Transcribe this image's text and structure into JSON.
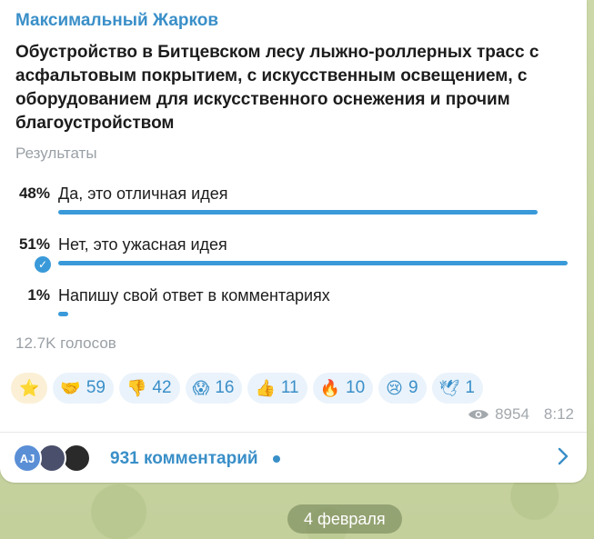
{
  "post": {
    "author": "Максимальный Жарков",
    "question": "Обустройство в Битцевском лесу лыжно-роллерных трасс с асфальтовым покрытием, с искусственным освещением, с оборудованием для искусственного оснежения и прочим благоустройством",
    "results_label": "Результаты",
    "options": [
      {
        "percent": "48%",
        "text": "Да, это отличная идея",
        "share": 0.48
      },
      {
        "percent": "51%",
        "text": "Нет, это ужасная идея",
        "share": 0.51,
        "chosen": true
      },
      {
        "percent": "1%",
        "text": "Напишу свой ответ в комментариях",
        "share": 0.01
      }
    ],
    "votes": "12.7K голосов",
    "reactions": [
      {
        "emoji": "⭐",
        "icon": "star-icon",
        "count": ""
      },
      {
        "emoji": "🤝",
        "icon": "handshake-icon",
        "count": "59"
      },
      {
        "emoji": "👎",
        "icon": "thumbs-down-icon",
        "count": "42"
      },
      {
        "emoji": "😱",
        "icon": "scream-icon",
        "count": "16"
      },
      {
        "emoji": "👍",
        "icon": "thumbs-up-icon",
        "count": "11"
      },
      {
        "emoji": "🔥",
        "icon": "fire-icon",
        "count": "10"
      },
      {
        "emoji": "😢",
        "icon": "cry-icon",
        "count": "9"
      },
      {
        "emoji": "🕊",
        "icon": "dove-icon",
        "count": "1"
      }
    ],
    "views": "8954",
    "time": "8:12",
    "comments": {
      "avatar_initials": "AJ",
      "label": "931 комментарий"
    }
  },
  "date_separator": "4 февраля",
  "colors": {
    "accent": "#3a8fc8",
    "bar": "#3a9ad9",
    "wallpaper": "#c9d4a4"
  }
}
